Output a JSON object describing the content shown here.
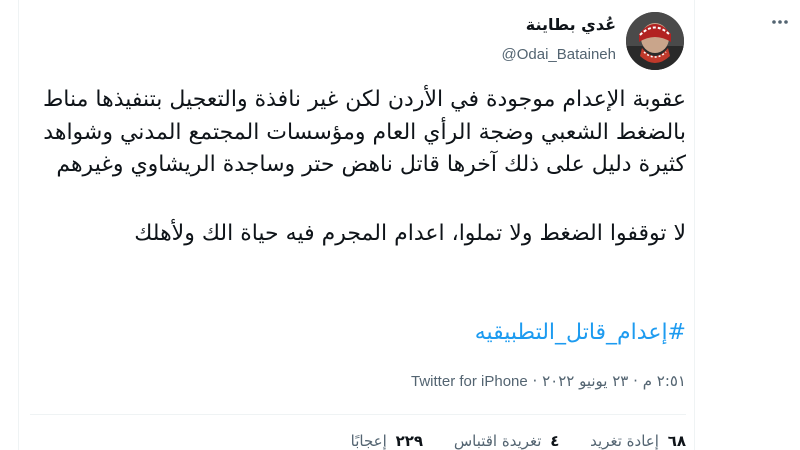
{
  "author": {
    "name": "عُدي بطاينة",
    "handle": "@Odai_Bataineh"
  },
  "tweet": {
    "paragraph1": "عقوبة الإعدام موجودة في الأردن لكن غير نافذة والتعجيل بتنفيذها مناط بالضغط الشعبي وضجة الرأي العام ومؤسسات المجتمع المدني وشواهد كثيرة دليل على ذلك آخرها قاتل ناهض حتر وساجدة الريشاوي وغيرهم",
    "paragraph2": "لا توقفوا الضغط ولا تملوا، اعدام المجرم فيه حياة الك ولأهلك",
    "hashtag": "#إعدام_قاتل_التطبيقيه"
  },
  "meta": {
    "time": "٢:٥١ م",
    "separator": "·",
    "date": "٢٣ يونيو ٢٠٢٢",
    "source": "Twitter for iPhone"
  },
  "stats": {
    "retweets_count": "٦٨",
    "retweets_label": "إعادة تغريد",
    "quotes_count": "٤",
    "quotes_label": "تغريدة اقتباس",
    "likes_count": "٢٢٩",
    "likes_label": "إعجابًا"
  },
  "colors": {
    "link": "#1d9bf0",
    "text": "#0f1419",
    "muted": "#536471"
  },
  "icons": {
    "more": "more-horizontal-icon"
  }
}
